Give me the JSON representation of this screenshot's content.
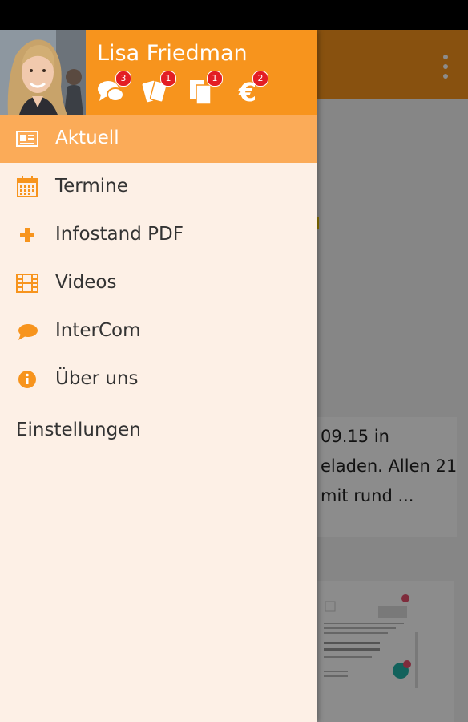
{
  "drawer": {
    "user_name": "Lisa Friedman",
    "badges": [
      {
        "icon": "chat-bubbles-icon",
        "count": "3"
      },
      {
        "icon": "tickets-icon",
        "count": "1"
      },
      {
        "icon": "documents-icon",
        "count": "1"
      },
      {
        "icon": "euro-icon",
        "count": "2"
      }
    ],
    "items": [
      {
        "label": "Aktuell",
        "icon": "newspaper-icon",
        "active": true
      },
      {
        "label": "Termine",
        "icon": "calendar-icon"
      },
      {
        "label": "Infostand PDF",
        "icon": "plus-icon"
      },
      {
        "label": "Videos",
        "icon": "film-icon"
      },
      {
        "label": "InterCom",
        "icon": "speech-bubble-icon"
      },
      {
        "label": "Über uns",
        "icon": "info-icon"
      }
    ],
    "settings_label": "Einstellungen"
  },
  "background": {
    "card_lines": [
      "09.15 in",
      "eladen. Allen 21",
      "mit rund ..."
    ]
  },
  "colors": {
    "primary": "#f7941d",
    "active_item": "#fbab58",
    "drawer_bg": "#fdf0e6",
    "badge": "#e31e24"
  }
}
